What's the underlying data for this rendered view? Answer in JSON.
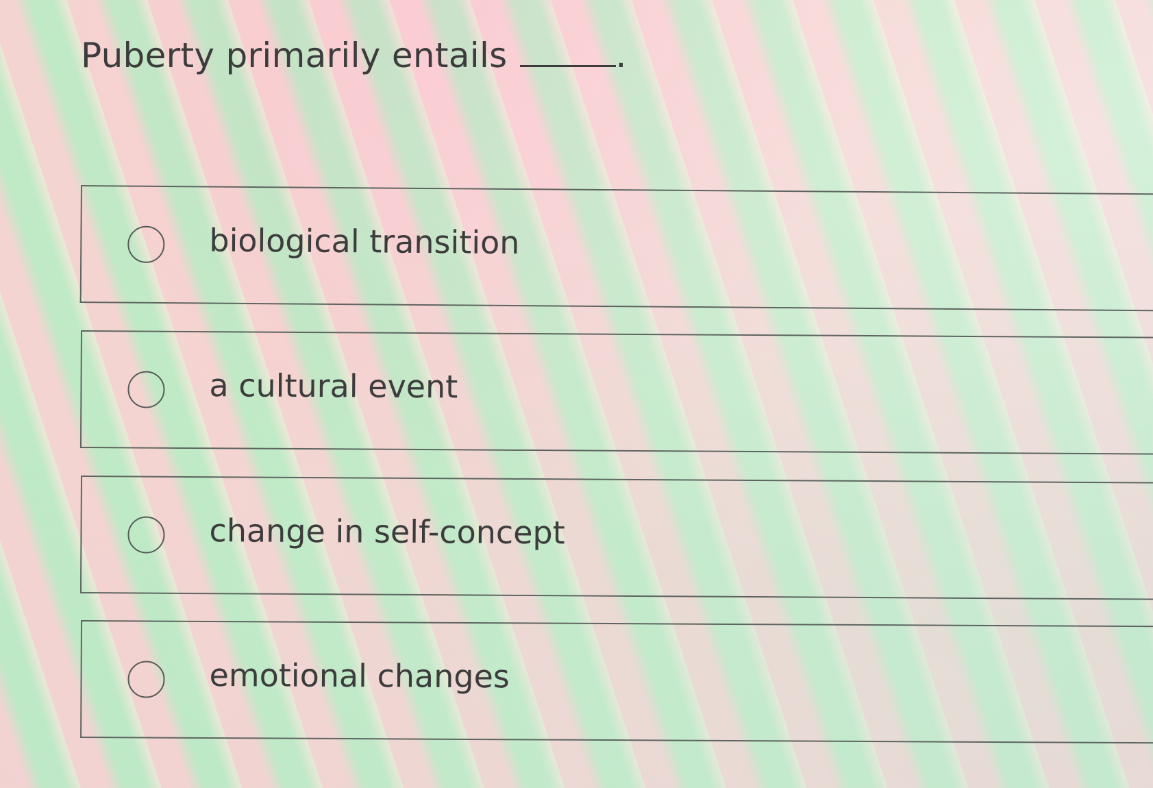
{
  "question": {
    "text": "Puberty primarily entails",
    "blank_suffix": "."
  },
  "options": [
    {
      "label": "biological transition",
      "selected": false
    },
    {
      "label": "a cultural event",
      "selected": false
    },
    {
      "label": "change in self-concept",
      "selected": false
    },
    {
      "label": "emotional changes",
      "selected": false
    }
  ]
}
